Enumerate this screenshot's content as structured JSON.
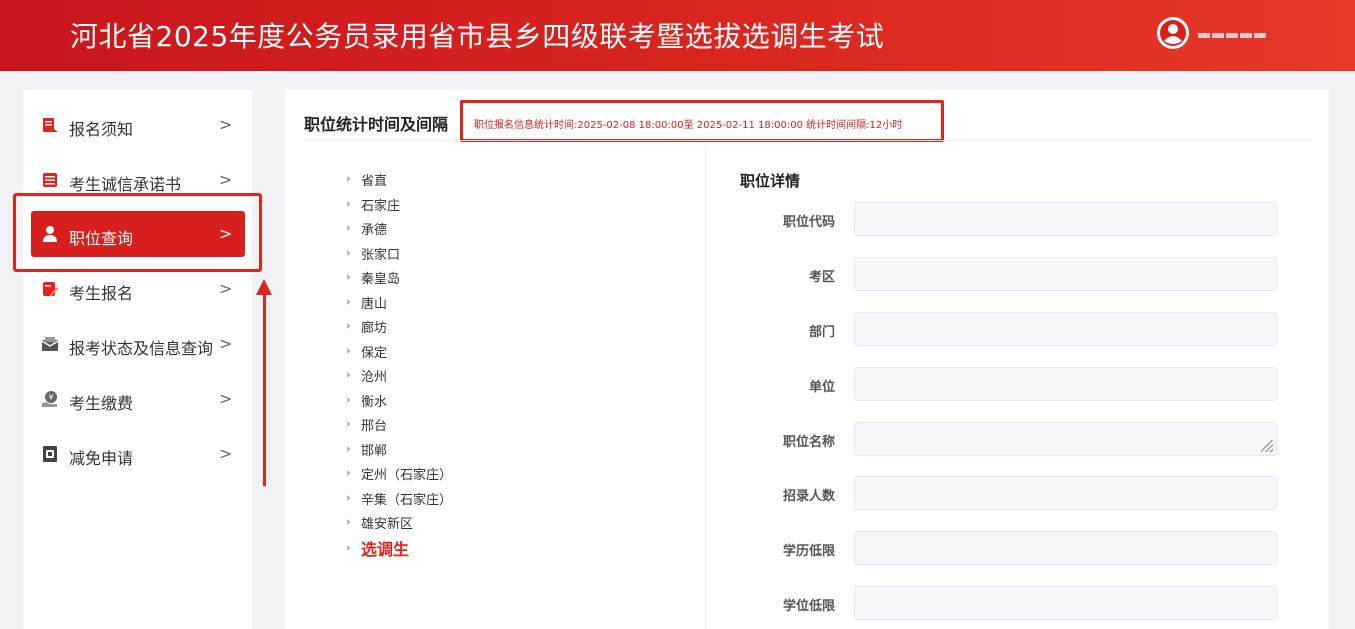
{
  "header": {
    "title": "河北省2025年度公务员录用省市县乡四级联考暨选拔选调生考试",
    "username": ""
  },
  "sidebar": {
    "items": [
      {
        "label": "报名须知",
        "icon": "notice-icon",
        "active": false
      },
      {
        "label": "考生诚信承诺书",
        "icon": "pledge-icon",
        "active": false
      },
      {
        "label": "职位查询",
        "icon": "user-icon",
        "active": true
      },
      {
        "label": "考生报名",
        "icon": "edit-icon",
        "active": false
      },
      {
        "label": "报考状态及信息查询",
        "icon": "mail-icon",
        "active": false
      },
      {
        "label": "考生缴费",
        "icon": "payment-icon",
        "active": false
      },
      {
        "label": "减免申请",
        "icon": "waiver-icon",
        "active": false
      }
    ],
    "chevron": ">"
  },
  "main": {
    "section_title": "职位统计时间及间隔",
    "stat_text": "职位报名信息统计时间:2025-02-08 18:00:00至 2025-02-11 18:00:00 统计时间间隔:12小时",
    "regions": [
      "省直",
      "石家庄",
      "承德",
      "张家口",
      "秦皇岛",
      "唐山",
      "廊坊",
      "保定",
      "沧州",
      "衡水",
      "邢台",
      "邯郸",
      "定州（石家庄）",
      "辛集（石家庄）",
      "雄安新区",
      "选调生"
    ],
    "detail": {
      "title": "职位详情",
      "fields": [
        "职位代码",
        "考区",
        "部门",
        "单位",
        "职位名称",
        "招录人数",
        "学历低限",
        "学位低限"
      ]
    }
  },
  "colors": {
    "brand_red": "#d7201d",
    "highlight_red": "#e2231a"
  }
}
